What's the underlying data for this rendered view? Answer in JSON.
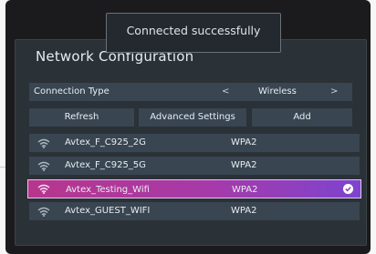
{
  "toast": {
    "message": "Connected successfully"
  },
  "dialog": {
    "title": "Network Configuration",
    "connection_type": {
      "label": "Connection Type",
      "value": "Wireless",
      "prev_glyph": "<",
      "next_glyph": ">"
    },
    "buttons": {
      "refresh": "Refresh",
      "advanced": "Advanced Settings",
      "add": "Add"
    },
    "networks": [
      {
        "ssid": "Avtex_F_C925_2G",
        "security": "WPA2",
        "icon": "wifi-icon",
        "selected": false
      },
      {
        "ssid": "Avtex_F_C925_5G",
        "security": "WPA2",
        "icon": "wifi-icon",
        "selected": false
      },
      {
        "ssid": "Avtex_Testing_Wifi",
        "security": "WPA2",
        "icon": "wifi-icon",
        "selected": true,
        "status_icon": "check-circle-icon"
      },
      {
        "ssid": "Avtex_GUEST_WIFI",
        "security": "WPA2",
        "icon": "wifi-icon",
        "selected": false
      }
    ]
  },
  "colors": {
    "panel_bg": "#2a3137",
    "row_bg": "#394551",
    "selected_gradient_start": "#b7368c",
    "selected_gradient_end": "#7d44cf",
    "text": "#e8edf1"
  }
}
